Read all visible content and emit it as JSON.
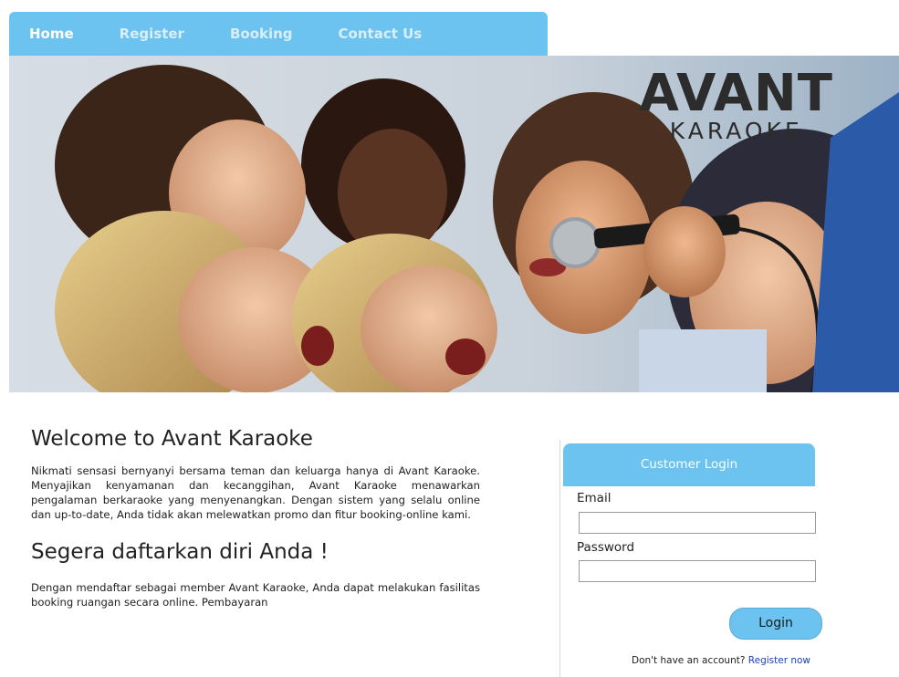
{
  "nav": {
    "items": [
      {
        "label": "Home"
      },
      {
        "label": "Register"
      },
      {
        "label": "Booking"
      },
      {
        "label": "Contact Us"
      }
    ]
  },
  "hero": {
    "brand_main": "AVANT",
    "brand_sub": "KARAOKE"
  },
  "main": {
    "welcome_title": "Welcome to Avant Karaoke",
    "welcome_text": "Nikmati sensasi bernyanyi bersama teman dan keluarga hanya di Avant Karaoke. Menyajikan kenyamanan dan kecanggihan, Avant Karaoke menawarkan pengalaman berkaraoke yang menyenangkan. Dengan sistem yang selalu online dan up-to-date, Anda tidak akan melewatkan promo dan fitur booking-online kami.",
    "register_title": "Segera daftarkan diri Anda !",
    "register_text": "Dengan mendaftar sebagai member Avant Karaoke, Anda dapat melakukan fasilitas booking ruangan secara online. Pembayaran"
  },
  "login": {
    "title": "Customer Login",
    "email_label": "Email",
    "email_value": "",
    "password_label": "Password",
    "password_value": "",
    "login_button": "Login",
    "no_account_text": "Don't have an account?",
    "register_link": "Register now"
  },
  "colors": {
    "accent": "#6cc3f0",
    "link": "#1a3fc4"
  }
}
